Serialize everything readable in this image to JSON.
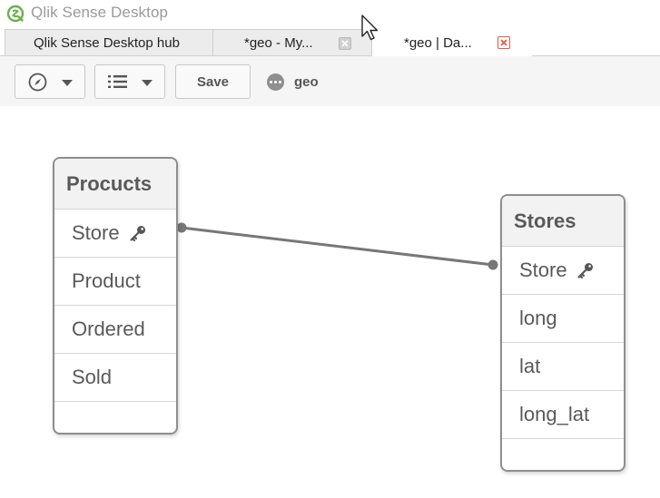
{
  "window": {
    "title": "Qlik Sense Desktop"
  },
  "tabs": [
    {
      "label": "Qlik Sense Desktop hub",
      "active": false,
      "close": "none"
    },
    {
      "label": "*geo - My...",
      "active": false,
      "close": "grey"
    },
    {
      "label": "*geo | Da...",
      "active": true,
      "close": "red"
    }
  ],
  "toolbar": {
    "navigation_icon": "compass-icon",
    "list_icon": "list-icon",
    "save_label": "Save",
    "app_icon": "more-dots-icon",
    "app_name": "geo"
  },
  "model": {
    "tables": [
      {
        "name": "Procucts",
        "fields": [
          {
            "label": "Store",
            "key": true
          },
          {
            "label": "Product",
            "key": false
          },
          {
            "label": "Ordered",
            "key": false
          },
          {
            "label": "Sold",
            "key": false
          }
        ]
      },
      {
        "name": "Stores",
        "fields": [
          {
            "label": "Store",
            "key": true
          },
          {
            "label": "long",
            "key": false
          },
          {
            "label": "lat",
            "key": false
          },
          {
            "label": "long_lat",
            "key": false
          }
        ]
      }
    ],
    "associations": [
      {
        "from_table": "Procucts",
        "from_field": "Store",
        "to_table": "Stores",
        "to_field": "Store"
      }
    ]
  },
  "colors": {
    "brand_green": "#6ab04c",
    "close_red": "#e05a4b",
    "link_grey": "#777777"
  }
}
